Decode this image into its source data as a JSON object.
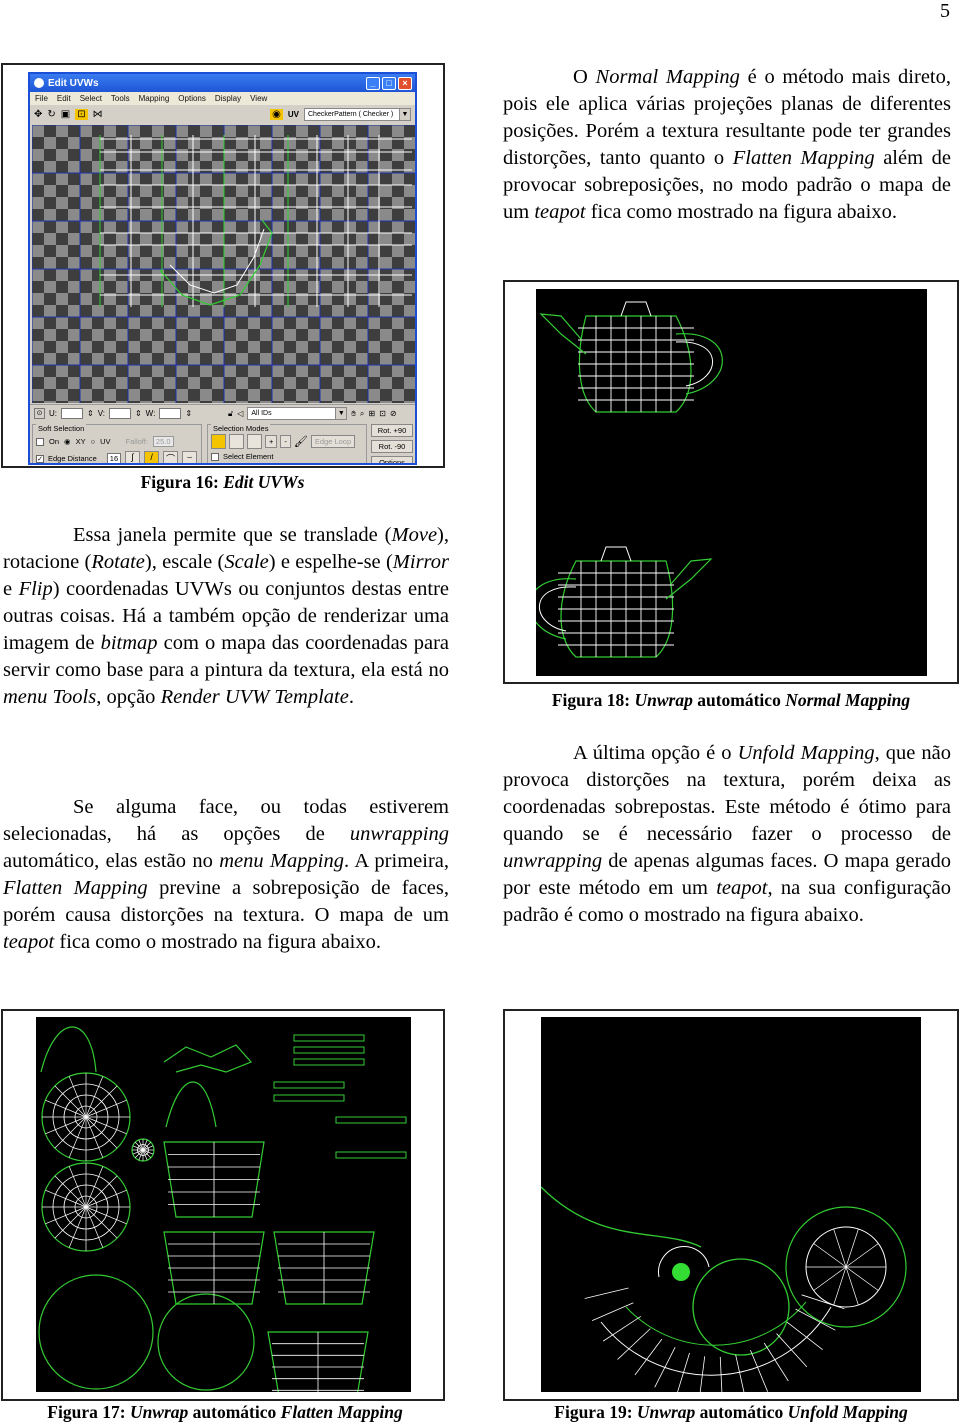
{
  "page_number": "5",
  "figure16": {
    "window": {
      "title": "Edit UVWs",
      "menu": [
        "File",
        "Edit",
        "Select",
        "Tools",
        "Mapping",
        "Options",
        "Display",
        "View"
      ],
      "toolbar_icons": [
        "move-icon",
        "rotate-icon",
        "scale-icon",
        "freeform-icon",
        "mirror-icon"
      ],
      "uv_label": "UV",
      "texture_dropdown": "CheckerPattern  ( Checker )",
      "coords": {
        "u_label": "U:",
        "v_label": "V:",
        "w_label": "W:"
      },
      "id_dropdown": "All IDs",
      "soft_selection": {
        "title": "Soft Selection",
        "on_label": "On",
        "xy_label": "XY",
        "uv_label": "UV",
        "falloff_label": "Falloff:",
        "falloff_value": "25.0",
        "edge_distance_label": "Edge Distance",
        "edge_distance_value": "16",
        "edge_distance_checked": true,
        "on_checked": false
      },
      "selection_modes": {
        "title": "Selection Modes",
        "plus": "+",
        "minus": "-",
        "edge_loop": "Edge Loop",
        "select_element": "Select Element"
      },
      "rot_plus": "Rot. +90",
      "rot_minus": "Rot. -90",
      "options": "Options",
      "colors": {
        "title_bar": "#1d55d6",
        "selected_mode": "#f5c400",
        "checker_dark": "#3e3e3e",
        "checker_light": "#8a8a8a"
      }
    },
    "caption_prefix": "Figura 16:",
    "caption_italic": "Edit UVWs"
  },
  "para_right_1": {
    "segments": [
      {
        "t": "O ",
        "i": false
      },
      {
        "t": "Normal Mapping",
        "i": true
      },
      {
        "t": " é o método mais direto, pois ele aplica várias projeções planas de diferentes posições. Porém a textura resultante pode ter grandes distorções, tanto quanto o ",
        "i": false
      },
      {
        "t": "Flatten Mapping",
        "i": true
      },
      {
        "t": " além de provocar sobreposições, no modo padrão o mapa de um ",
        "i": false
      },
      {
        "t": "teapot",
        "i": true
      },
      {
        "t": " fica como mostrado na figura abaixo.",
        "i": false
      }
    ]
  },
  "para_left_1": {
    "segments": [
      {
        "t": "Essa janela permite que se translade (",
        "i": false
      },
      {
        "t": "Move",
        "i": true
      },
      {
        "t": "), rotacione (",
        "i": false
      },
      {
        "t": "Rotate",
        "i": true
      },
      {
        "t": "), escale (",
        "i": false
      },
      {
        "t": "Scale",
        "i": true
      },
      {
        "t": ") e espelhe-se (",
        "i": false
      },
      {
        "t": "Mirror",
        "i": true
      },
      {
        "t": " e ",
        "i": false
      },
      {
        "t": "Flip",
        "i": true
      },
      {
        "t": ") coordenadas UVWs ou conjuntos destas entre outras coisas. Há a também opção de renderizar uma imagem de ",
        "i": false
      },
      {
        "t": "bitmap",
        "i": true
      },
      {
        "t": " com o mapa das coordenadas para servir como base para a pintura da textura, ela está no ",
        "i": false
      },
      {
        "t": "menu Tools",
        "i": true
      },
      {
        "t": ", opção ",
        "i": false
      },
      {
        "t": "Render UVW Template",
        "i": true
      },
      {
        "t": ".",
        "i": false
      }
    ]
  },
  "para_left_2": {
    "segments": [
      {
        "t": "Se alguma face, ou todas estiverem selecionadas, há as opções de ",
        "i": false
      },
      {
        "t": "unwrapping",
        "i": true
      },
      {
        "t": " automático, elas estão no ",
        "i": false
      },
      {
        "t": "menu Mapping",
        "i": true
      },
      {
        "t": ". A primeira, ",
        "i": false
      },
      {
        "t": "Flatten Mapping",
        "i": true
      },
      {
        "t": " previne a sobreposição de faces, porém causa distorções na textura. O mapa de um ",
        "i": false
      },
      {
        "t": "teapot",
        "i": true
      },
      {
        "t": " fica como o mostrado na figura abaixo.",
        "i": false
      }
    ]
  },
  "para_right_2": {
    "segments": [
      {
        "t": "A última opção é o ",
        "i": false
      },
      {
        "t": "Unfold Mapping",
        "i": true
      },
      {
        "t": ", que não provoca distorções na textura, porém deixa as coordenadas sobrepostas. Este método é ótimo para quando se é necessário fazer o processo de ",
        "i": false
      },
      {
        "t": "unwrapping",
        "i": true
      },
      {
        "t": " de apenas algumas faces. O mapa gerado por este método em um ",
        "i": false
      },
      {
        "t": "teapot",
        "i": true
      },
      {
        "t": ", na sua configuração padrão é como o mostrado na figura abaixo.",
        "i": false
      }
    ]
  },
  "figure17": {
    "prefix": "Figura 17:",
    "italic1": "Unwrap",
    "middle": " automático ",
    "italic2": "Flatten Mapping"
  },
  "figure18": {
    "prefix": "Figura 18:",
    "italic1": "Unwrap",
    "middle": " automático ",
    "italic2": "Normal Mapping"
  },
  "figure19": {
    "prefix": "Figura 19:",
    "italic1": "Unwrap",
    "middle": " automático ",
    "italic2": "Unfold Mapping"
  },
  "wireframe_colors": {
    "edge": "#ffffff",
    "seam": "#33cc33",
    "background": "#000000"
  }
}
